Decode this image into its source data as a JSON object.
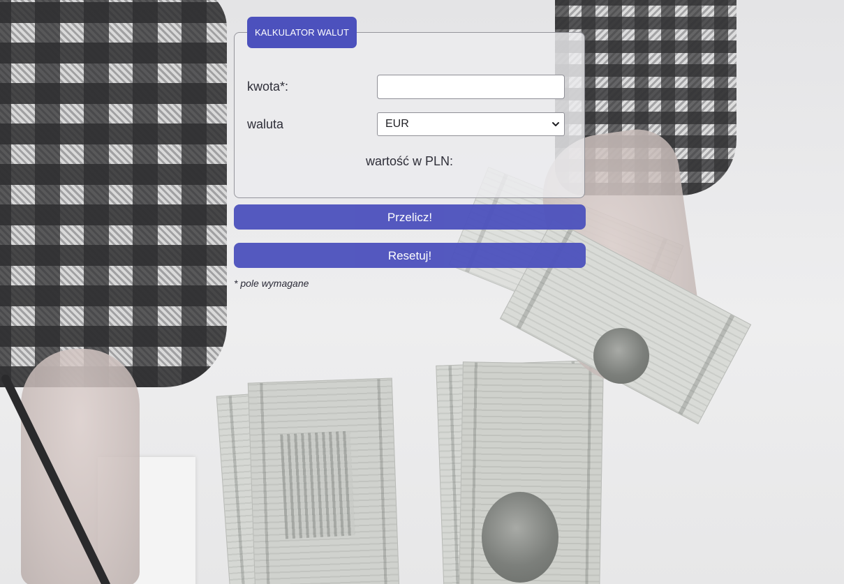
{
  "form": {
    "legend": "KALKULATOR WALUT",
    "amount_label": "kwota*:",
    "amount_value": "",
    "currency_label": "waluta",
    "currency_selected": "EUR",
    "result_label": "wartość w PLN:"
  },
  "buttons": {
    "calculate": "Przelicz!",
    "reset": "Resetuj!"
  },
  "note": "* pole wymagane",
  "colors": {
    "accent": "#4c51bd",
    "panel_border": "#7a7a82"
  }
}
